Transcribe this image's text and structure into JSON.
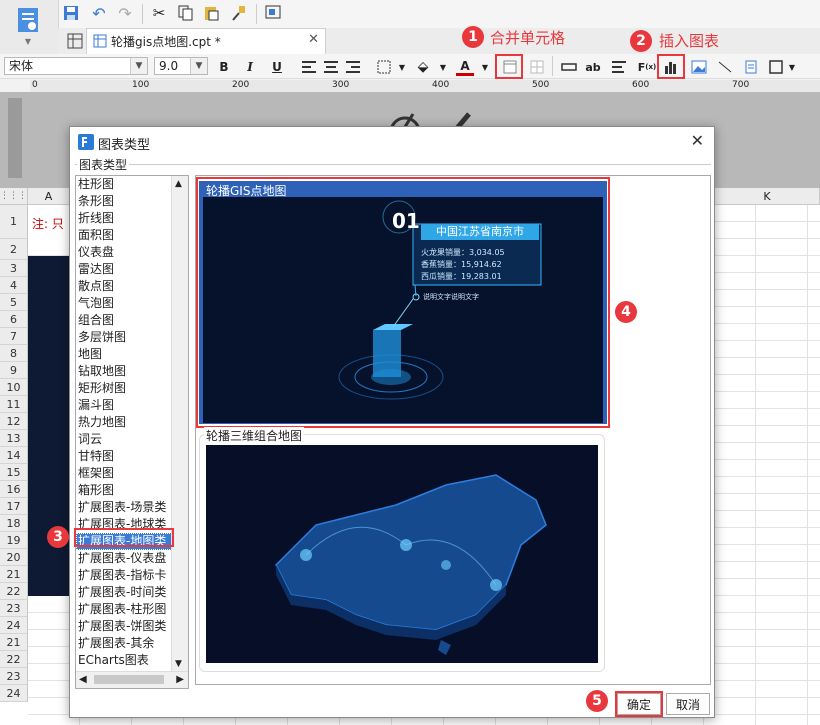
{
  "toolbar": {
    "tab_title": "轮播gis点地图.cpt *",
    "font_name": "宋体",
    "font_size": "9.0"
  },
  "annotations": {
    "merge_cells": {
      "num": "1",
      "label": "合并单元格"
    },
    "insert_chart": {
      "num": "2",
      "label": "插入图表"
    },
    "category": {
      "num": "3"
    },
    "gis_chart": {
      "num": "4"
    },
    "confirm": {
      "num": "5"
    }
  },
  "ruler": {
    "ticks": [
      "0",
      "100",
      "200",
      "300",
      "400",
      "500",
      "600",
      "700"
    ]
  },
  "sheet": {
    "columns": [
      "A",
      "K"
    ],
    "rows": [
      "1",
      "2",
      "3",
      "4",
      "5",
      "6",
      "7",
      "8",
      "9",
      "10",
      "11",
      "12",
      "13",
      "14",
      "15",
      "16",
      "17",
      "18",
      "19",
      "20",
      "21",
      "22",
      "23",
      "24"
    ],
    "cell_a1": "注: 只"
  },
  "dialog": {
    "title": "图表类型",
    "group_label": "图表类型",
    "categories": [
      "柱形图",
      "条形图",
      "折线图",
      "面积图",
      "仪表盘",
      "雷达图",
      "散点图",
      "气泡图",
      "组合图",
      "多层饼图",
      "地图",
      "钻取地图",
      "矩形树图",
      "漏斗图",
      "热力地图",
      "词云",
      "甘特图",
      "框架图",
      "箱形图",
      "扩展图表-场景类",
      "扩展图表-地球类",
      "扩展图表-地图类",
      "扩展图表-仪表盘",
      "扩展图表-指标卡",
      "扩展图表-时间类",
      "扩展图表-柱形图",
      "扩展图表-饼图类",
      "扩展图表-其余",
      "ECharts图表"
    ],
    "selected_index": 21,
    "charts": [
      {
        "title": "轮播GIS点地图",
        "badge_num": "01",
        "city": "中国江苏省南京市",
        "stats": [
          "火龙果销量：3,034.05",
          "香蕉销量：15,914.62",
          "西瓜销量：19,283.01"
        ],
        "caption": "说明文字说明文字"
      },
      {
        "title": "轮播三维组合地图"
      }
    ],
    "ok_label": "确定",
    "cancel_label": "取消"
  }
}
